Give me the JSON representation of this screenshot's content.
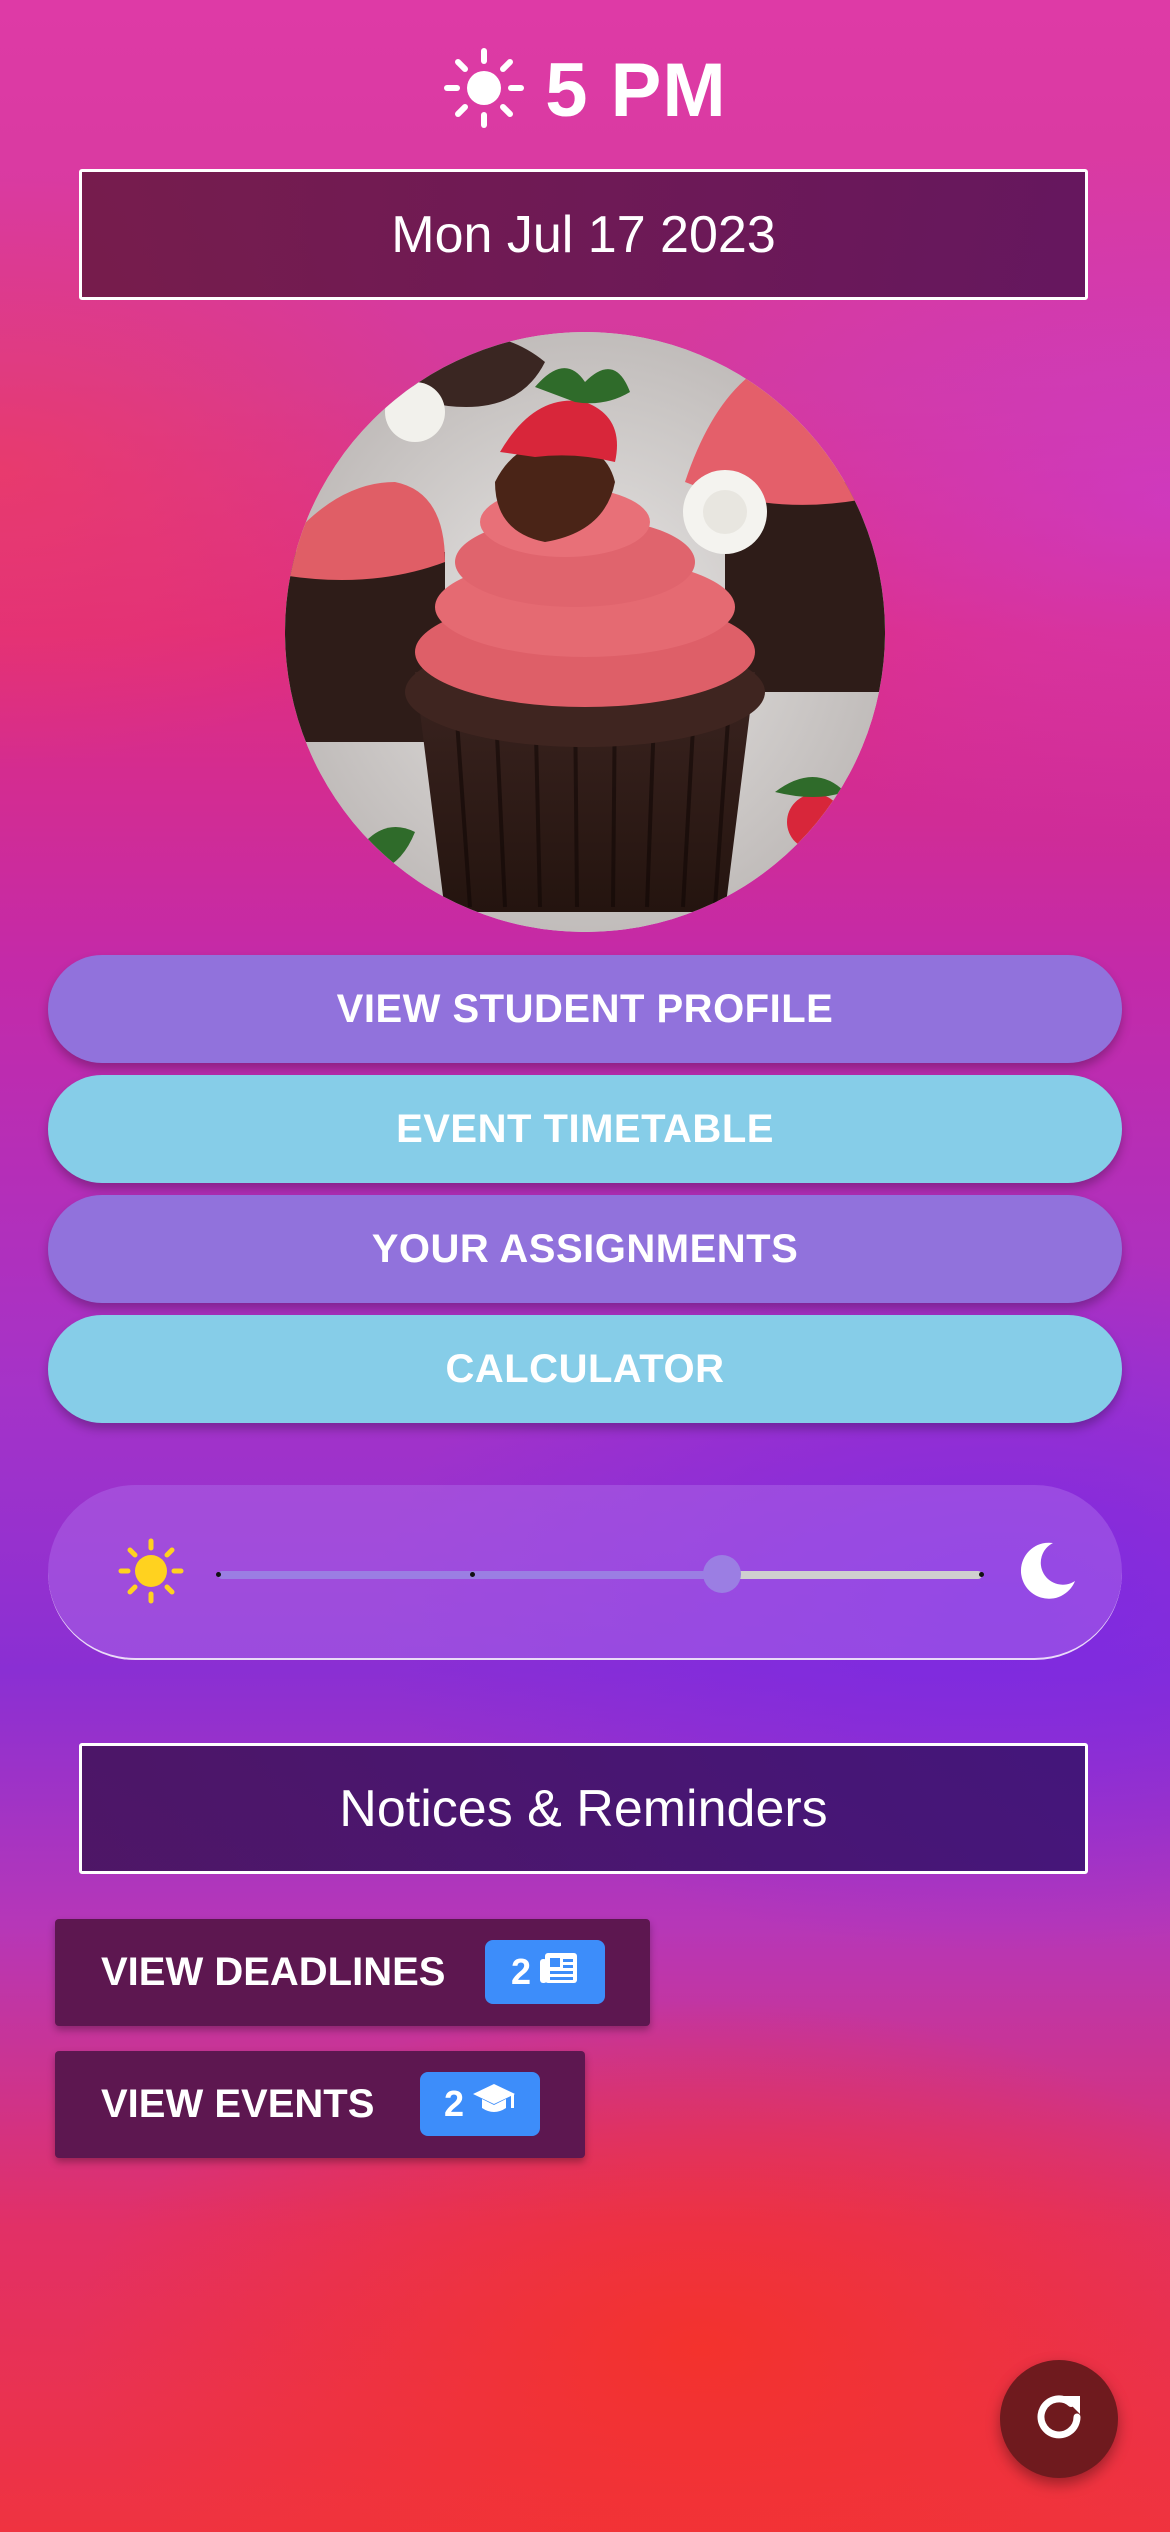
{
  "header": {
    "time": "5 PM",
    "weather_icon": "sun-icon"
  },
  "date": "Mon Jul 17 2023",
  "photo": {
    "subject": "chocolate cupcake with pink frosting and strawberry"
  },
  "menu": {
    "profile": "VIEW STUDENT PROFILE",
    "timetable": "EVENT TIMETABLE",
    "assignments": "YOUR ASSIGNMENTS",
    "calculator": "CALCULATOR"
  },
  "theme_slider": {
    "left_icon": "sun-icon",
    "right_icon": "moon-icon",
    "value_fraction": 0.66,
    "steps": 3
  },
  "notices": {
    "title": "Notices & Reminders",
    "deadlines": {
      "label": "VIEW DEADLINES",
      "count": "2",
      "icon": "newspaper-icon"
    },
    "events": {
      "label": "VIEW EVENTS",
      "count": "2",
      "icon": "graduation-cap-icon"
    }
  },
  "fab_icon": "refresh-icon",
  "colors": {
    "purple_button": "#9172dc",
    "blue_button": "#86cde8",
    "badge": "#3d8dfa",
    "fab": "#6f1a1e"
  }
}
